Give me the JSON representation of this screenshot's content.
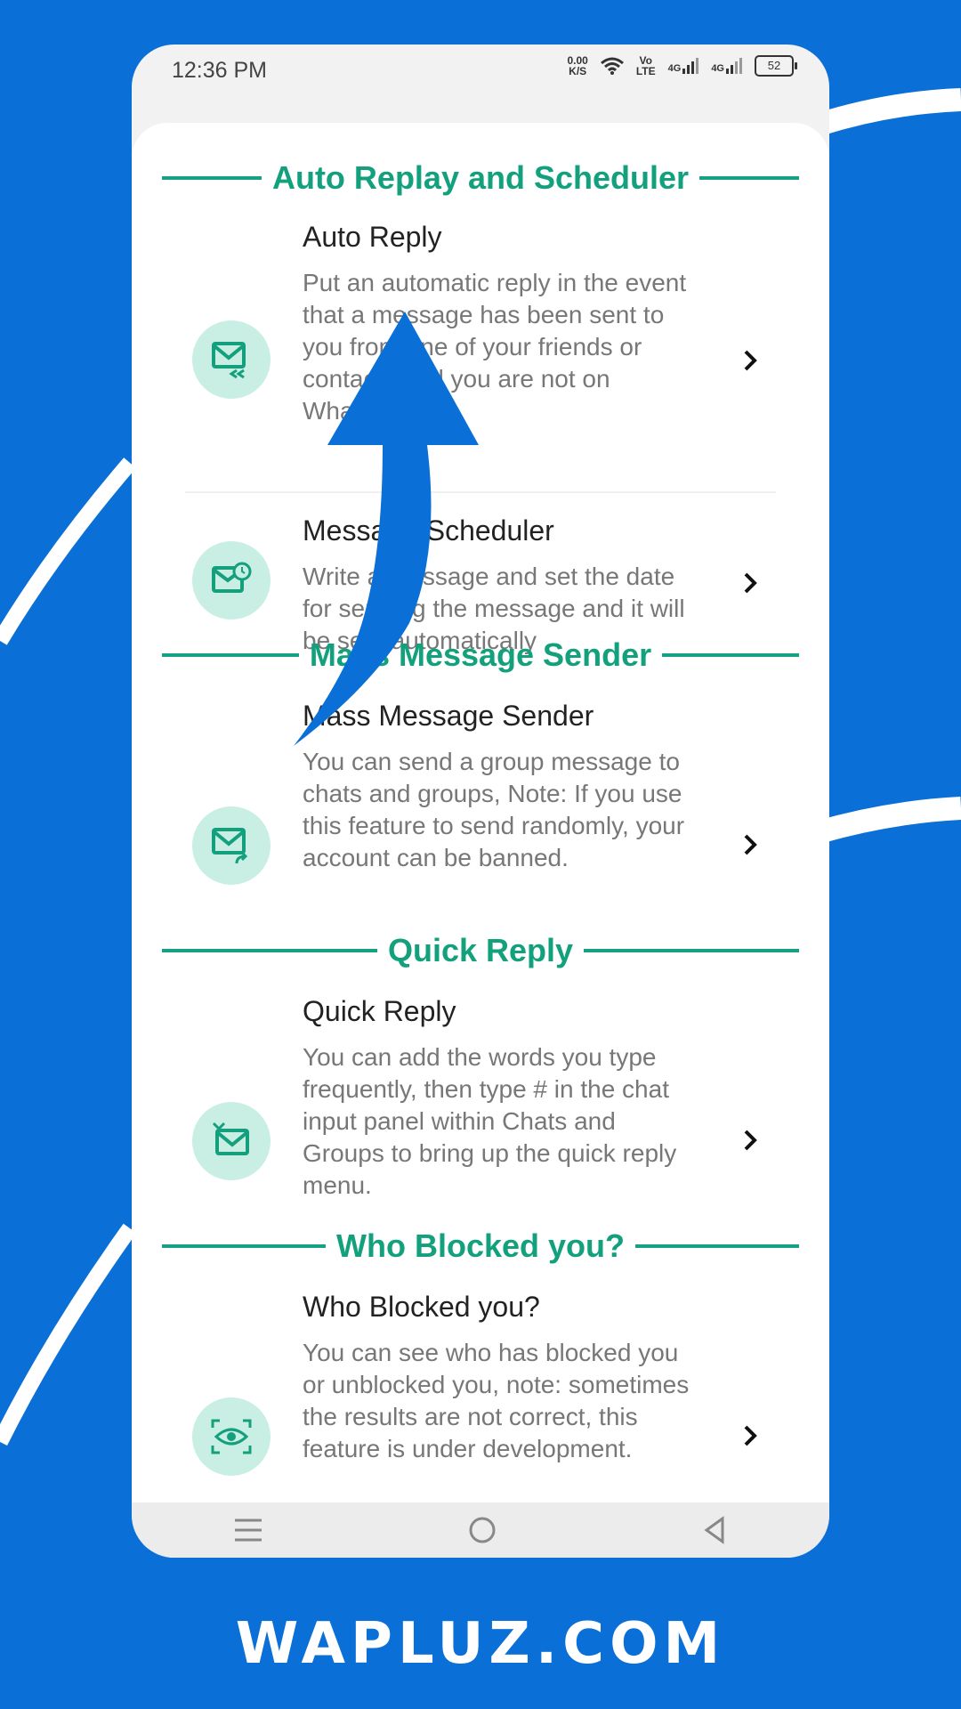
{
  "status": {
    "time": "12:36 PM",
    "speed": "0.00\nK/S",
    "volte": "Vo\nLTE",
    "net1": "4G",
    "net2": "4G",
    "battery": "52"
  },
  "sections": [
    {
      "title": "Auto Replay and Scheduler",
      "items": [
        {
          "title": "Auto Reply",
          "desc": "Put an automatic reply in the event that a message has been sent to you from one of your friends or contacts and you are not on WhatsApp.",
          "icon": "mail-reply-icon"
        },
        {
          "title": "Message Scheduler",
          "desc": "Write a message and set the date for sending the message and it will be sent automatically",
          "icon": "mail-clock-icon"
        }
      ]
    },
    {
      "title": "Mass Message Sender",
      "items": [
        {
          "title": "Mass Message Sender",
          "desc": "You can send a group message to chats and groups, Note: If you use this feature to send randomly, your account can be banned.",
          "icon": "mail-forward-icon"
        }
      ]
    },
    {
      "title": "Quick Reply",
      "items": [
        {
          "title": "Quick Reply",
          "desc": "You can add the words you type frequently, then type # in the chat input panel within Chats and Groups to bring up the quick reply menu.",
          "icon": "mail-quick-icon"
        }
      ]
    },
    {
      "title": "Who Blocked you?",
      "items": [
        {
          "title": "Who Blocked you?",
          "desc": "You can see who has blocked you or unblocked you, note: sometimes the results are not correct, this feature is under development.",
          "icon": "eye-scan-icon"
        }
      ]
    }
  ],
  "footer": "WAPLUZ.COM",
  "colors": {
    "accent": "#13a07c",
    "icon_bg": "#c9efe4",
    "background": "#0a6fd6"
  }
}
